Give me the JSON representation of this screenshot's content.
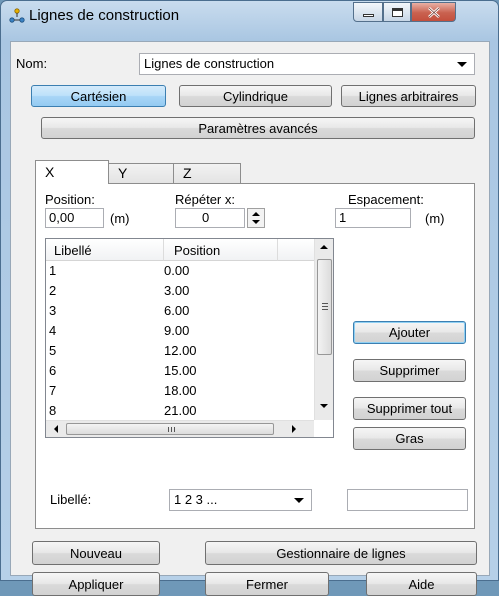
{
  "window": {
    "title": "Lignes de construction",
    "icon": "grid-lines-icon",
    "controls": [
      "minimize-icon",
      "maximize-icon",
      "close-icon"
    ]
  },
  "name": {
    "label": "Nom:",
    "value": "Lignes de construction"
  },
  "modes": {
    "cartesian": "Cartésien",
    "cylindrical": "Cylindrique",
    "arbitrary": "Lignes arbitraires",
    "selected": "Cartésien"
  },
  "advanced_button": "Paramètres avancés",
  "tabs": [
    {
      "label": "X",
      "active": true
    },
    {
      "label": "Y",
      "active": false
    },
    {
      "label": "Z",
      "active": false
    }
  ],
  "position": {
    "label": "Position:",
    "value": "0,00",
    "unit": "(m)"
  },
  "repeat": {
    "label": "Répéter x:",
    "value": "0"
  },
  "spacing": {
    "label": "Espacement:",
    "value": "1",
    "unit": "(m)"
  },
  "list": {
    "headers": [
      "Libellé",
      "Position"
    ],
    "rows": [
      [
        "1",
        "0.00"
      ],
      [
        "2",
        "3.00"
      ],
      [
        "3",
        "6.00"
      ],
      [
        "4",
        "9.00"
      ],
      [
        "5",
        "12.00"
      ],
      [
        "6",
        "15.00"
      ],
      [
        "7",
        "18.00"
      ],
      [
        "8",
        "21.00"
      ]
    ]
  },
  "side_buttons": {
    "add": "Ajouter",
    "delete": "Supprimer",
    "delete_all": "Supprimer tout",
    "bold": "Gras"
  },
  "label_select": {
    "label": "Libellé:",
    "value": "1 2 3 ..."
  },
  "label_text": "",
  "bottom_buttons": {
    "new": "Nouveau",
    "manager": "Gestionnaire de lignes",
    "apply": "Appliquer",
    "close": "Fermer",
    "help": "Aide"
  }
}
